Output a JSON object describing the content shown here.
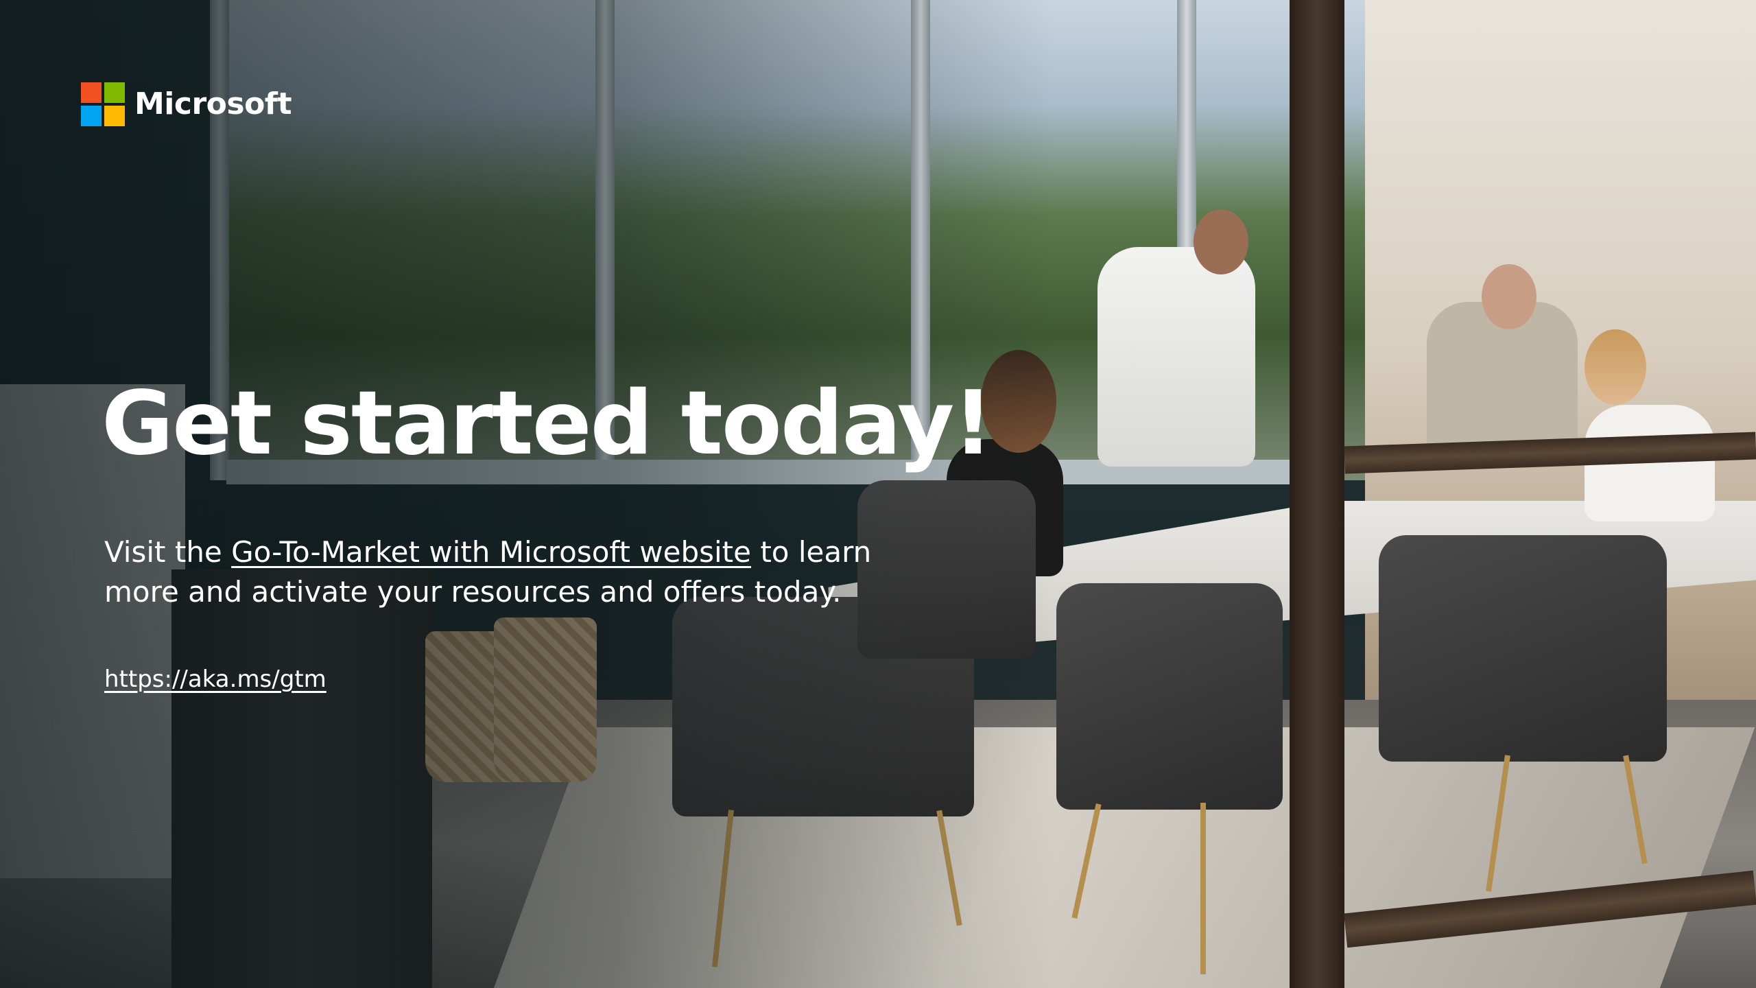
{
  "brand": {
    "name": "Microsoft",
    "logo_colors": [
      "#f25022",
      "#7fba00",
      "#00a4ef",
      "#ffb900"
    ]
  },
  "slide": {
    "headline": "Get started today!",
    "body_prefix": "Visit the ",
    "body_link": "Go-To-Market with Microsoft website",
    "body_suffix": " to learn more and activate your resources and offers today.",
    "url": "https://aka.ms/gtm"
  }
}
